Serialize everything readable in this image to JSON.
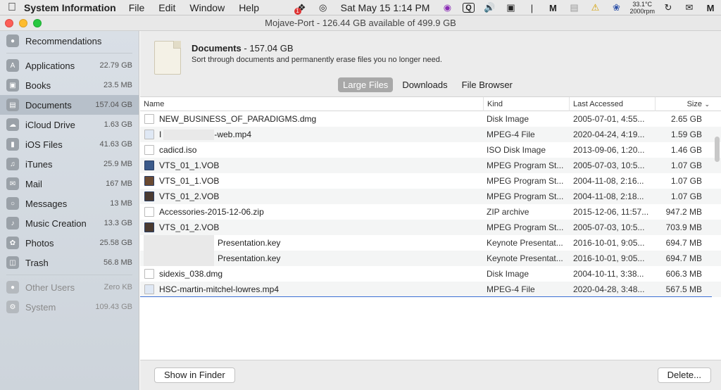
{
  "menubar": {
    "app_name": "System Information",
    "menus": [
      "File",
      "Edit",
      "Window",
      "Help"
    ],
    "clock": "Sat May 15  1:14 PM",
    "badge": "1",
    "temp": "33.1°C",
    "fan": "2000rpm"
  },
  "window": {
    "title": "Mojave-Port - 126.44 GB available of 499.9 GB"
  },
  "sidebar": {
    "items": [
      {
        "label": "Recommendations",
        "size": "",
        "icon": "lightbulb-icon"
      },
      {
        "label": "Applications",
        "size": "22.79 GB",
        "icon": "applications-icon"
      },
      {
        "label": "Books",
        "size": "23.5 MB",
        "icon": "book-icon"
      },
      {
        "label": "Documents",
        "size": "157.04 GB",
        "icon": "document-icon",
        "active": true
      },
      {
        "label": "iCloud Drive",
        "size": "1.63 GB",
        "icon": "cloud-icon"
      },
      {
        "label": "iOS Files",
        "size": "41.63 GB",
        "icon": "phone-icon"
      },
      {
        "label": "iTunes",
        "size": "25.9 MB",
        "icon": "music-note-icon"
      },
      {
        "label": "Mail",
        "size": "167 MB",
        "icon": "mail-icon"
      },
      {
        "label": "Messages",
        "size": "13 MB",
        "icon": "chat-bubble-icon"
      },
      {
        "label": "Music Creation",
        "size": "13.3 GB",
        "icon": "guitar-icon"
      },
      {
        "label": "Photos",
        "size": "25.58 GB",
        "icon": "photos-icon"
      },
      {
        "label": "Trash",
        "size": "56.8 MB",
        "icon": "trash-icon"
      }
    ],
    "other_items": [
      {
        "label": "Other Users",
        "size": "Zero KB",
        "icon": "users-icon"
      },
      {
        "label": "System",
        "size": "109.43 GB",
        "icon": "gear-icon"
      }
    ]
  },
  "header": {
    "title": "Documents",
    "size": " - 157.04 GB",
    "description": "Sort through documents and permanently erase files you no longer need."
  },
  "tabs": [
    "Large Files",
    "Downloads",
    "File Browser"
  ],
  "table": {
    "columns": [
      "Name",
      "Kind",
      "Last Accessed",
      "Size"
    ],
    "rows": [
      {
        "name": "NEW_BUSINESS_OF_PARADIGMS.dmg",
        "kind": "Disk Image",
        "accessed": "2005-07-01, 4:55...",
        "size": "2.65 GB"
      },
      {
        "name_prefix": "I",
        "name": "-web.mp4",
        "kind": "MPEG-4 File",
        "accessed": "2020-04-24, 4:19...",
        "size": "1.59 GB"
      },
      {
        "name": "cadicd.iso",
        "kind": "ISO Disk Image",
        "accessed": "2013-09-06, 1:20...",
        "size": "1.46 GB"
      },
      {
        "name": "VTS_01_1.VOB",
        "kind": "MPEG Program St...",
        "accessed": "2005-07-03, 10:5...",
        "size": "1.07 GB"
      },
      {
        "name": "VTS_01_1.VOB",
        "kind": "MPEG Program St...",
        "accessed": "2004-11-08, 2:16...",
        "size": "1.07 GB"
      },
      {
        "name": "VTS_01_2.VOB",
        "kind": "MPEG Program St...",
        "accessed": "2004-11-08, 2:18...",
        "size": "1.07 GB"
      },
      {
        "name": "Accessories-2015-12-06.zip",
        "kind": "ZIP archive",
        "accessed": "2015-12-06, 11:57...",
        "size": "947.2 MB"
      },
      {
        "name": "VTS_01_2.VOB",
        "kind": "MPEG Program St...",
        "accessed": "2005-07-03, 10:5...",
        "size": "703.9 MB"
      },
      {
        "name": "Presentation.key",
        "kind": "Keynote Presentat...",
        "accessed": "2016-10-01, 9:05...",
        "size": "694.7 MB"
      },
      {
        "name": "Presentation.key",
        "kind": "Keynote Presentat...",
        "accessed": "2016-10-01, 9:05...",
        "size": "694.7 MB"
      },
      {
        "name": "sidexis_038.dmg",
        "kind": "Disk Image",
        "accessed": "2004-10-11, 3:38...",
        "size": "606.3 MB"
      },
      {
        "name": "HSC-martin-mitchel-lowres.mp4",
        "kind": "MPEG-4 File",
        "accessed": "2020-04-28, 3:48...",
        "size": "567.5 MB"
      }
    ]
  },
  "footer": {
    "show_in_finder": "Show in Finder",
    "delete": "Delete..."
  }
}
